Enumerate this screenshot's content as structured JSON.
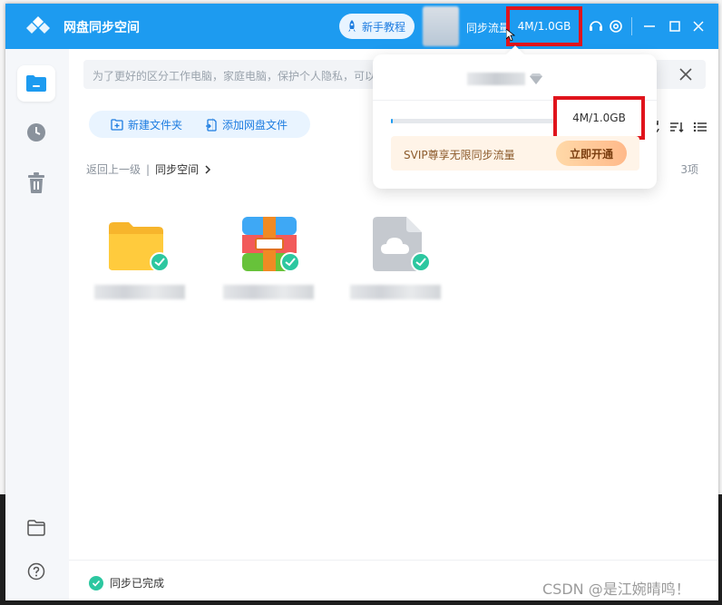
{
  "window": {
    "title": "网盘同步空间"
  },
  "titlebar": {
    "tutorial_label": "新手教程",
    "sync_label": "同步流量",
    "quota": "4M/1.0GB"
  },
  "notice": {
    "text": "为了更好的区分工作电脑，家庭电脑，保护个人隐私，可以"
  },
  "actions": {
    "new_folder": "新建文件夹",
    "add_file": "添加网盘文件"
  },
  "breadcrumb": {
    "back": "返回上一级",
    "current": "同步空间",
    "separator": "|"
  },
  "list": {
    "count": "3项"
  },
  "files": [
    {
      "type": "folder",
      "status": "synced"
    },
    {
      "type": "archive",
      "status": "synced"
    },
    {
      "type": "cloud-file",
      "status": "synced"
    }
  ],
  "status": {
    "text": "同步已完成"
  },
  "popover": {
    "quota": "4M/1.0GB",
    "progress": 0.004,
    "svip_text": "SVIP尊享无限同步流量",
    "svip_button": "立即开通"
  },
  "watermark": "CSDN @是江婉晴鸣！",
  "colors": {
    "accent": "#1d9bf0",
    "synced": "#2cc7a0",
    "highlight": "#e0141c"
  }
}
